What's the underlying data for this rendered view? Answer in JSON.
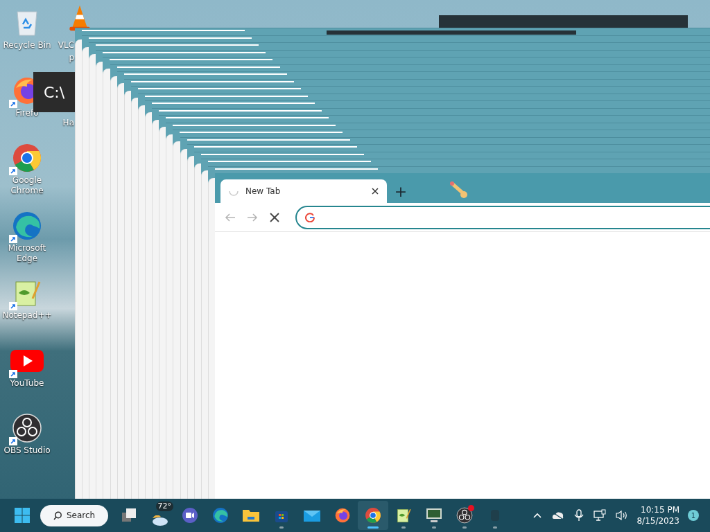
{
  "desktop_icons": [
    {
      "kind": "recycle",
      "lines": [
        "Recycle Bin"
      ],
      "shortcut": false
    },
    {
      "kind": "firefox",
      "lines": [
        "Firefo"
      ],
      "shortcut": true
    },
    {
      "kind": "chrome",
      "lines": [
        "Google",
        "Chrome"
      ],
      "shortcut": true
    },
    {
      "kind": "edge",
      "lines": [
        "Microsoft",
        "Edge"
      ],
      "shortcut": true
    },
    {
      "kind": "notepad",
      "lines": [
        "Notepad++"
      ],
      "shortcut": true
    },
    {
      "kind": "youtube",
      "lines": [
        "YouTube"
      ],
      "shortcut": true
    },
    {
      "kind": "obs",
      "lines": [
        "OBS Studio"
      ],
      "shortcut": true
    }
  ],
  "desktop_icons_column_2": [
    {
      "icon_visible": true,
      "lines": [
        "VLC",
        "p"
      ]
    },
    {
      "icon_visible": false,
      "lines": [
        "Ha"
      ]
    }
  ],
  "console_tooltip": "C:\\",
  "browser": {
    "tabs": [
      {
        "title": "New Tab",
        "selected": true,
        "loading": true
      }
    ],
    "new_tab_label": "+",
    "back_disabled": true,
    "forward_disabled": true,
    "omnibox": {
      "focused": true
    }
  },
  "taskbar": {
    "search_label": "Search",
    "apps": [
      {
        "kind": "taskview",
        "running": false,
        "active": false
      },
      {
        "kind": "weather",
        "badge": "72°",
        "running": false,
        "active": false
      },
      {
        "kind": "teams",
        "running": false,
        "active": false
      },
      {
        "kind": "edge",
        "running": false,
        "active": false
      },
      {
        "kind": "explorer",
        "running": false,
        "active": false
      },
      {
        "kind": "store",
        "running": true,
        "active": false
      },
      {
        "kind": "mail",
        "running": false,
        "active": false
      },
      {
        "kind": "firefox",
        "running": false,
        "active": false
      },
      {
        "kind": "chrome",
        "running": true,
        "active": true
      },
      {
        "kind": "notepad",
        "running": true,
        "active": false
      },
      {
        "kind": "monitor",
        "running": true,
        "active": false
      },
      {
        "kind": "obs",
        "running": true,
        "active": false,
        "alert": true
      },
      {
        "kind": "ghost",
        "running": true,
        "active": false
      }
    ],
    "clock": {
      "time": "10:15 PM",
      "date": "8/15/2023"
    },
    "notifications": "1"
  }
}
